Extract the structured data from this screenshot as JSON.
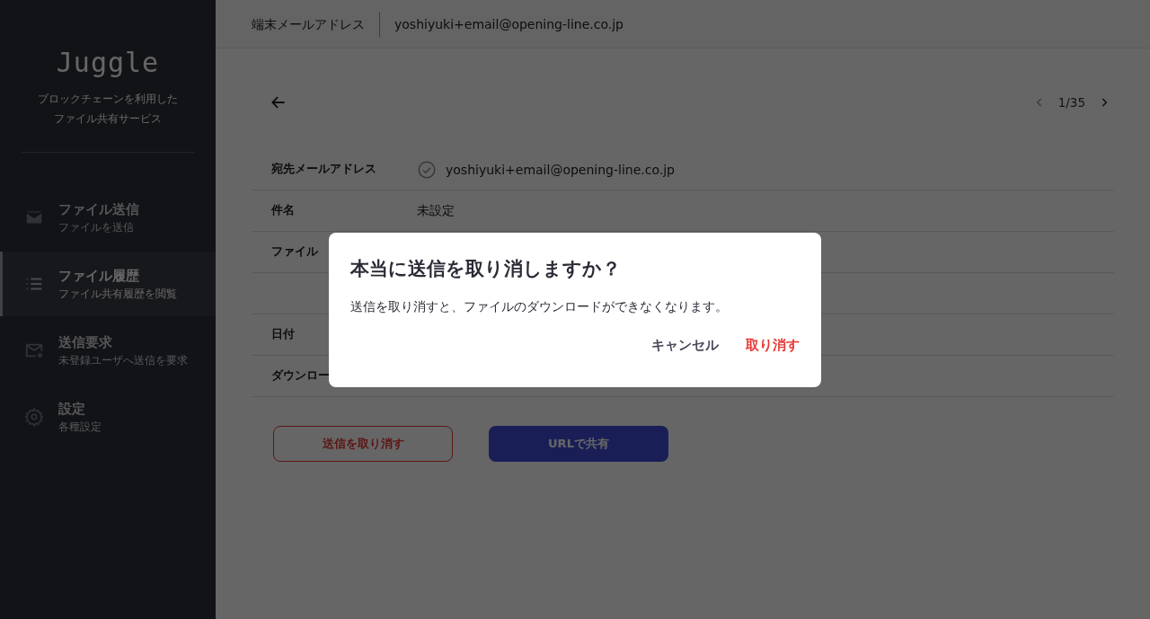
{
  "sidebar": {
    "logo": "Juggle",
    "tagline_lines": [
      "ブロックチェーンを利用した",
      "ファイル共有サービス"
    ],
    "items": [
      {
        "kind": "mail",
        "title": "ファイル送信",
        "subtitle": "ファイルを送信",
        "selected": false
      },
      {
        "kind": "list",
        "title": "ファイル履歴",
        "subtitle": "ファイル共有履歴を閲覧",
        "selected": true
      },
      {
        "kind": "mail-plus",
        "title": "送信要求",
        "subtitle": "未登録ユーザへ送信を要求",
        "selected": false
      },
      {
        "kind": "gear",
        "title": "設定",
        "subtitle": "各種設定",
        "selected": false
      }
    ]
  },
  "top_bar": {
    "label": "端末メールアドレス",
    "email": "yoshiyuki+email@opening-line.co.jp"
  },
  "pager": {
    "position": "1/35"
  },
  "details": [
    {
      "kind": "field",
      "label": "宛先メールアドレス",
      "value": "yoshiyuki+email@opening-line.co.jp",
      "verified": true
    },
    {
      "kind": "field",
      "label": "件名",
      "value": "未設定"
    },
    {
      "kind": "field",
      "label": "ファイル"
    },
    {
      "kind": "blank"
    },
    {
      "kind": "field",
      "label": "日付"
    },
    {
      "kind": "field",
      "label": "ダウンロー"
    }
  ],
  "actions": {
    "cancel_send": "送信を取り消す",
    "share_url": "URLで共有"
  },
  "dialog": {
    "title": "本当に送信を取り消しますか？",
    "message": "送信を取り消すと、ファイルのダウンロードができなくなります。",
    "cancel": "キャンセル",
    "confirm": "取り消す"
  }
}
